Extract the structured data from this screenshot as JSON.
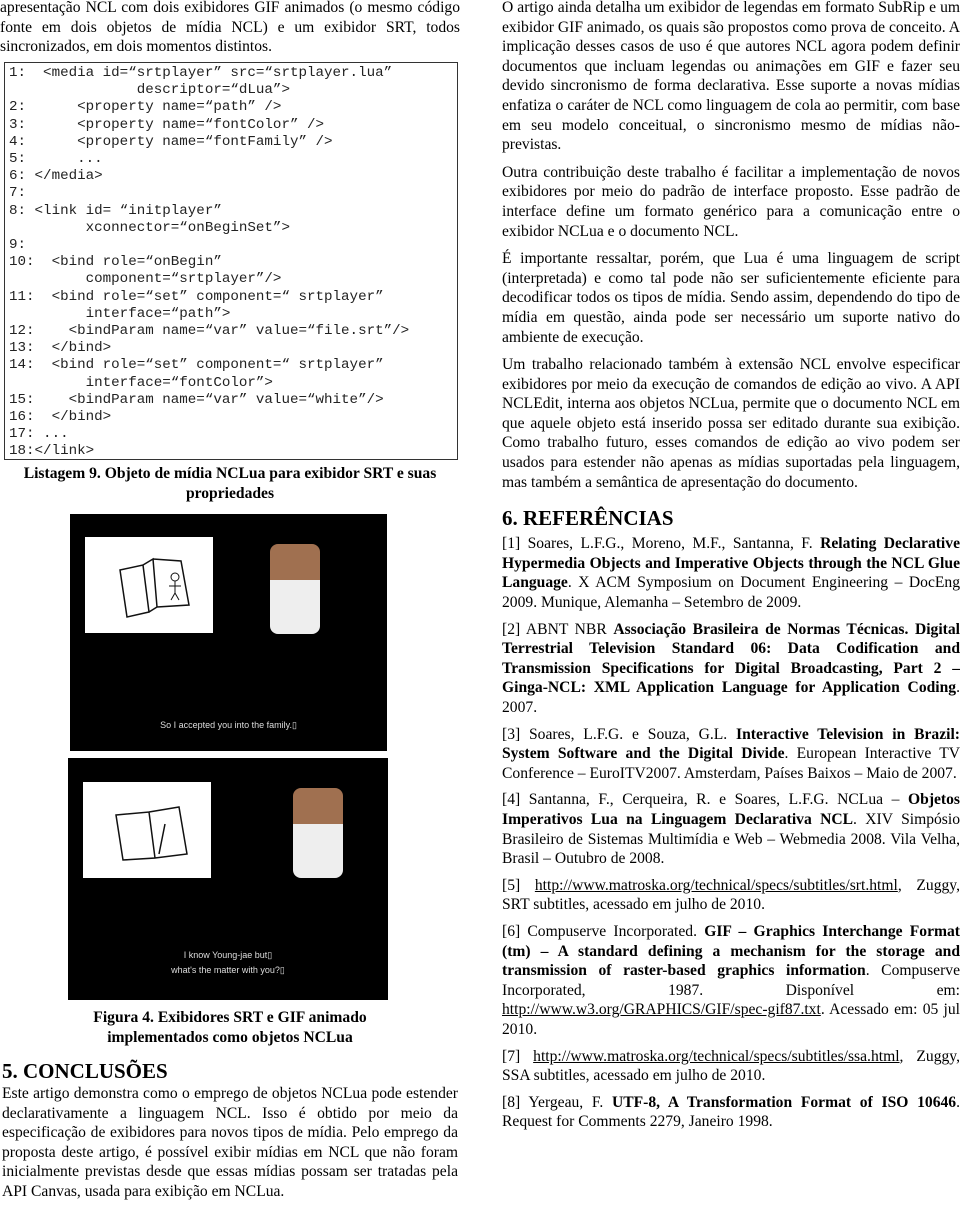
{
  "left": {
    "intro": "apresentação NCL com dois exibidores GIF animados (o mesmo código fonte em dois objetos de mídia NCL) e um exibidor SRT, todos sincronizados, em dois momentos distintos.",
    "listing_code": [
      "1:  <media id=“srtplayer” src=“srtplayer.lua”",
      "               descriptor=“dLua”>",
      "2:      <property name=“path” />",
      "3:      <property name=“fontColor” />",
      "4:      <property name=“fontFamily” />",
      "5:      ...",
      "6: </media>",
      "7:",
      "8: <link id= “initplayer”",
      "         xconnector=“onBeginSet”>",
      "9:",
      "10:  <bind role=“onBegin”",
      "         component=“srtplayer”/>",
      "11:  <bind role=“set” component=“ srtplayer”",
      "         interface=“path”>",
      "12:    <bindParam name=“var” value=“file.srt”/>",
      "13:  </bind>",
      "14:  <bind role=“set” component=“ srtplayer”",
      "         interface=“fontColor”>",
      "15:    <bindParam name=“var” value=“white”/>",
      "16:  </bind>",
      "17: ...",
      "18:</link>"
    ],
    "listing_caption": "Listagem 9. Objeto de mídia NCLua para exibidor SRT e suas propriedades",
    "figure": {
      "subtitle_1": "So I accepted you into the family.▯",
      "subtitle_2a": "I know Young-jae but▯",
      "subtitle_2b": "what's the matter with you?▯",
      "caption": "Figura 4. Exibidores SRT e GIF animado implementados como objetos NCLua"
    },
    "section_5_title": "5. CONCLUSÕES",
    "section_5_text": "Este artigo demonstra como o emprego de objetos NCLua pode estender declarativamente a linguagem NCL. Isso é obtido por meio da especificação de exibidores para novos tipos de mídia. Pelo emprego da proposta deste artigo, é possível exibir mídias em NCL que não foram inicialmente previstas desde que essas mídias possam ser tratadas pela API Canvas, usada para exibição em NCLua."
  },
  "right": {
    "paragraphs": [
      "O artigo ainda detalha um exibidor de legendas em formato SubRip e um exibidor GIF animado, os quais são propostos como prova de conceito. A implicação desses casos de uso é que autores NCL agora podem definir documentos que incluam legendas ou animações em GIF e fazer seu devido sincronismo de forma declarativa. Esse suporte a novas mídias enfatiza o caráter de NCL como linguagem de cola ao permitir, com base em seu modelo conceitual, o sincronismo mesmo de mídias não-previstas.",
      "Outra contribuição deste trabalho é facilitar a implementação de novos exibidores por meio do padrão de interface proposto. Esse padrão de interface define um formato genérico para a comunicação entre o exibidor NCLua e o documento NCL.",
      "É importante ressaltar, porém, que Lua é uma linguagem de script (interpretada) e como tal pode não ser suficientemente eficiente para decodificar todos os tipos de mídia. Sendo assim, dependendo do tipo de mídia em questão, ainda pode ser necessário um suporte nativo do ambiente de execução.",
      "Um trabalho relacionado também à extensão NCL envolve especificar exibidores por meio da execução de comandos de edição ao vivo. A API NCLEdit, interna aos objetos NCLua, permite que o documento NCL em que aquele objeto está inserido possa ser editado durante sua exibição. Como trabalho futuro, esses comandos de edição ao vivo podem ser usados para estender não apenas as mídias suportadas pela linguagem, mas também a semântica de apresentação do documento."
    ],
    "section_6_title": "6. REFERÊNCIAS",
    "references": [
      {
        "pre": "[1] Soares, L.F.G., Moreno, M.F., Santanna, F. ",
        "bold": "Relating Declarative Hypermedia Objects and Imperative Objects through the NCL Glue Language",
        "post": ". X ACM Symposium on Document Engineering – DocEng 2009. Munique, Alemanha – Setembro de 2009."
      },
      {
        "pre": "[2] ABNT NBR ",
        "bold": "Associação Brasileira de Normas Técnicas. Digital Terrestrial Television Standard 06: Data Codification and Transmission Specifications for Digital Broadcasting, Part 2 – Ginga-NCL: XML Application Language for Application Coding",
        "post": ". 2007."
      },
      {
        "pre": "[3] Soares, L.F.G. e Souza, G.L. ",
        "bold": "Interactive Television in Brazil: System Software and the Digital Divide",
        "post": ". European Interactive TV Conference – EuroITV2007. Amsterdam, Países Baixos – Maio de 2007."
      },
      {
        "pre": "[4] Santanna, F., Cerqueira, R. e Soares, L.F.G. NCLua – ",
        "bold": "Objetos Imperativos Lua na Linguagem Declarativa NCL",
        "post": ". XIV Simpósio Brasileiro de Sistemas Multimídia e Web – Webmedia 2008. Vila Velha, Brasil – Outubro de 2008."
      },
      {
        "pre": "[5] ",
        "link": "http://www.matroska.org/technical/specs/subtitles/srt.html",
        "post": ", Zuggy, SRT subtitles, acessado em julho de 2010."
      },
      {
        "pre": "[6] Compuserve Incorporated. ",
        "bold": "GIF – Graphics Interchange Format (tm) – A standard defining a mechanism for the storage and transmission of raster-based graphics information",
        "post": ". Compuserve Incorporated, 1987. Disponível em: ",
        "link": "http://www.w3.org/GRAPHICS/GIF/spec-gif87.txt",
        "post2": ". Acessado em: 05 jul 2010."
      },
      {
        "pre": "[7] ",
        "link": "http://www.matroska.org/technical/specs/subtitles/ssa.html",
        "post": ", Zuggy, SSA subtitles, acessado em julho de 2010."
      },
      {
        "pre": "[8] Yergeau, F. ",
        "bold": "UTF-8, A Transformation Format of ISO 10646",
        "post": ". Request for Comments 2279, Janeiro 1998."
      }
    ]
  }
}
